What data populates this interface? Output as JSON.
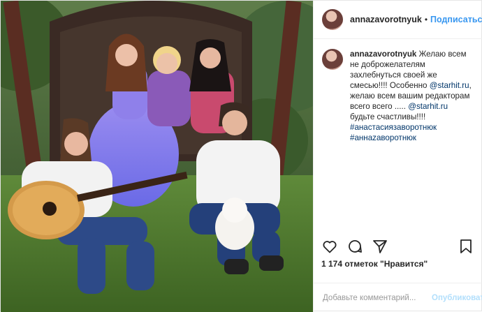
{
  "post": {
    "username": "annazavorotnyuk",
    "separator": "•",
    "follow_label": "Подписаться",
    "caption": {
      "username": "annazavorotnyuk",
      "text_1": "Желаю всем не доброжелателям захлебнуться своей же смесью!!!! Особенно",
      "mention_1": "@starhit.ru",
      "text_2": ", желаю всем вашим редакторам всего всего .....",
      "mention_2": "@starhit.ru",
      "text_3": "будьте счастливы!!!!",
      "hashtag_1": "#анастасиязаворотнюк",
      "hashtag_2": "#аннazаворотнюк"
    },
    "likes": "1 174 отметок \"Нравится\"",
    "time": "",
    "comment_placeholder": "Добавьте комментарий...",
    "publish_label": "Опубликовать",
    "icons": [
      "heart-icon",
      "comment-icon",
      "share-icon",
      "bookmark-icon"
    ]
  },
  "colors": {
    "link": "#003569",
    "follow": "#3897f0",
    "publish_disabled": "#b2dffc"
  }
}
